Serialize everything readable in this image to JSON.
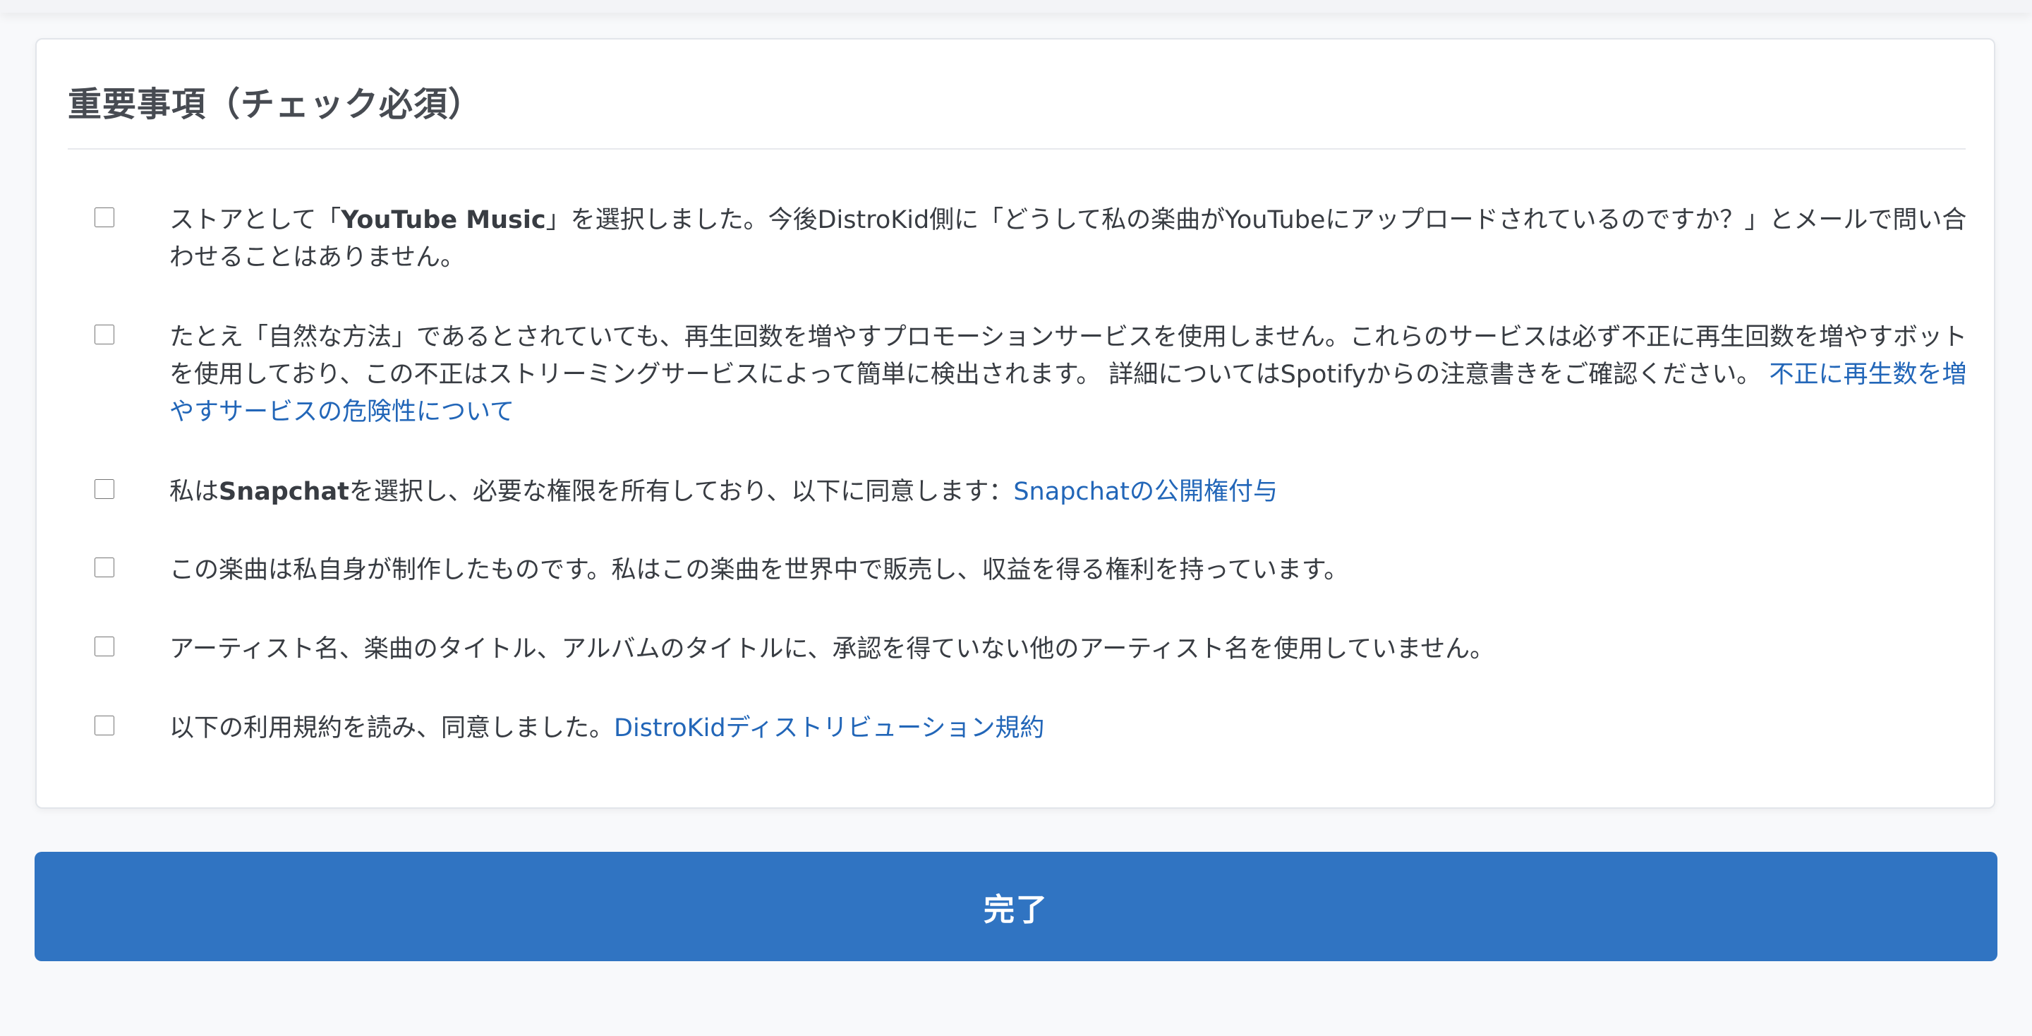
{
  "section": {
    "title": "重要事項（チェック必須）"
  },
  "items": [
    {
      "pre": "ストアとして「",
      "bold": "YouTube Music",
      "post": "」を選択しました。今後DistroKid側に「どうして私の楽曲がYouTubeにアップロードされているのですか？」とメールで問い合わせることはありません。",
      "checked": false
    },
    {
      "pre": "たとえ「自然な方法」であるとされていても、再生回数を増やすプロモーションサービスを使用しません。これらのサービスは必ず不正に再生回数を増やすボットを使用しており、この不正はストリーミングサービスによって簡単に検出されます。 詳細についてはSpotifyからの注意書きをご確認ください。",
      "link": "不正に再生数を増やすサービスの危険性について",
      "checked": false
    },
    {
      "pre": "私は",
      "bold": "Snapchat",
      "post": "を選択し、必要な権限を所有しており、以下に同意します：",
      "link": "Snapchatの公開権付与",
      "checked": false
    },
    {
      "pre": "この楽曲は私自身が制作したものです。私はこの楽曲を世界中で販売し、収益を得る権利を持っています。",
      "checked": false
    },
    {
      "pre": "アーティスト名、楽曲のタイトル、アルバムのタイトルに、承認を得ていない他のアーティスト名を使用していません。",
      "checked": false
    },
    {
      "pre": "以下の利用規約を読み、同意しました。",
      "link": "DistroKidディストリビューション規約",
      "checked": false
    }
  ],
  "submit": {
    "label": "完了"
  },
  "colors": {
    "link": "#2266b8",
    "button": "#3074c2",
    "page_bg": "#f8f9fb"
  }
}
